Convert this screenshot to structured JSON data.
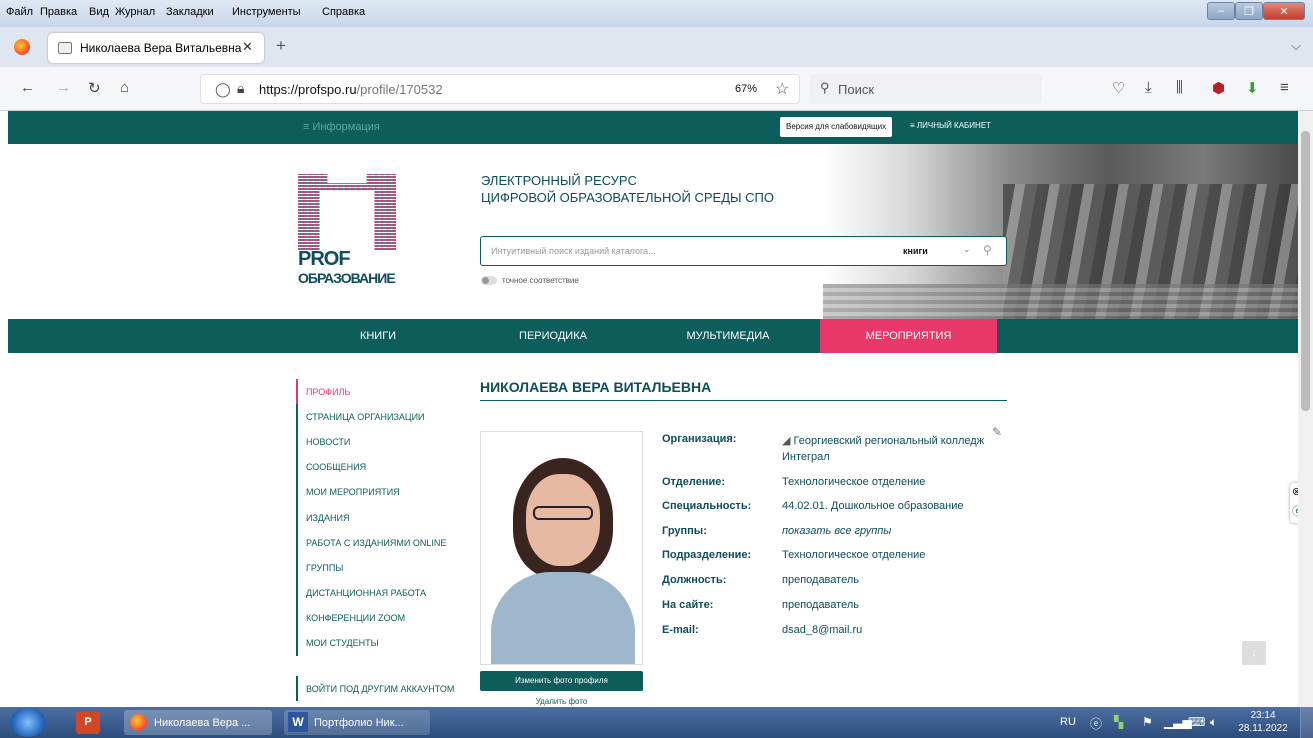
{
  "menubar": {
    "items": [
      "Файл",
      "Правка",
      "Вид",
      "Журнал",
      "Закладки",
      "Инструменты",
      "Справка"
    ]
  },
  "browser": {
    "tab_title": "Николаева Вера Витальевна",
    "url_host": "https://profspo.ru",
    "url_path": "/profile/170532",
    "zoom": "67%",
    "search_placeholder": "Поиск"
  },
  "site": {
    "top": {
      "info": "Информация",
      "low_vision": "Версия для слабовидящих",
      "cabinet": "ЛИЧНЫЙ КАБИНЕТ"
    },
    "hero": {
      "title_line1": "ЭЛЕКТРОННЫЙ РЕСУРС",
      "title_line2": "ЦИФРОВОЙ ОБРАЗОВАТЕЛЬНОЙ СРЕДЫ СПО",
      "search_placeholder": "Интуитивный поиск изданий каталога...",
      "search_scope": "книги",
      "exact_match": "точное соответствие",
      "logo_line1": "PROF",
      "logo_line2": "ОБРАЗОВАНИЕ"
    },
    "nav": [
      "КНИГИ",
      "ПЕРИОДИКА",
      "МУЛЬТИМЕДИА",
      "МЕРОПРИЯТИЯ"
    ],
    "sidebar": [
      "ПРОФИЛЬ",
      "СТРАНИЦА ОРГАНИЗАЦИИ",
      "НОВОСТИ",
      "СООБЩЕНИЯ",
      "МОИ МЕРОПРИЯТИЯ",
      "ИЗДАНИЯ",
      "РАБОТА С ИЗДАНИЯМИ ONLINE",
      "ГРУППЫ",
      "ДИСТАНЦИОННАЯ РАБОТА",
      "КОНФЕРЕНЦИИ ZOOM",
      "МОИ СТУДЕНТЫ"
    ],
    "sidebar_other_account": "ВОЙТИ ПОД ДРУГИМ АККАУНТОМ",
    "profile": {
      "name": "НИКОЛАЕВА ВЕРА ВИТАЛЬЕВНА",
      "change_photo": "Изменить фото профиля",
      "delete_photo": "Удалить фото",
      "fields": [
        {
          "label": "Организация:",
          "value": "Георгиевский региональный колледж Интеграл"
        },
        {
          "label": "Отделение:",
          "value": "Технологическое отделение"
        },
        {
          "label": "Специальность:",
          "value": "44.02.01. Дошкольное образование"
        },
        {
          "label": "Группы:",
          "value": "показать все группы"
        },
        {
          "label": "Подразделение:",
          "value": "Технологическое отделение"
        },
        {
          "label": "Должность:",
          "value": "преподаватель"
        },
        {
          "label": "На сайте:",
          "value": "преподаватель"
        },
        {
          "label": "E-mail:",
          "value": "dsad_8@mail.ru"
        }
      ]
    }
  },
  "taskbar": {
    "items": [
      "Николаева Вера ...",
      "Портфолио Ник..."
    ],
    "lang": "RU",
    "time": "23:14",
    "date": "28.11.2022"
  },
  "colors": {
    "teal": "#0d5d5c",
    "pink": "#e8386a"
  }
}
